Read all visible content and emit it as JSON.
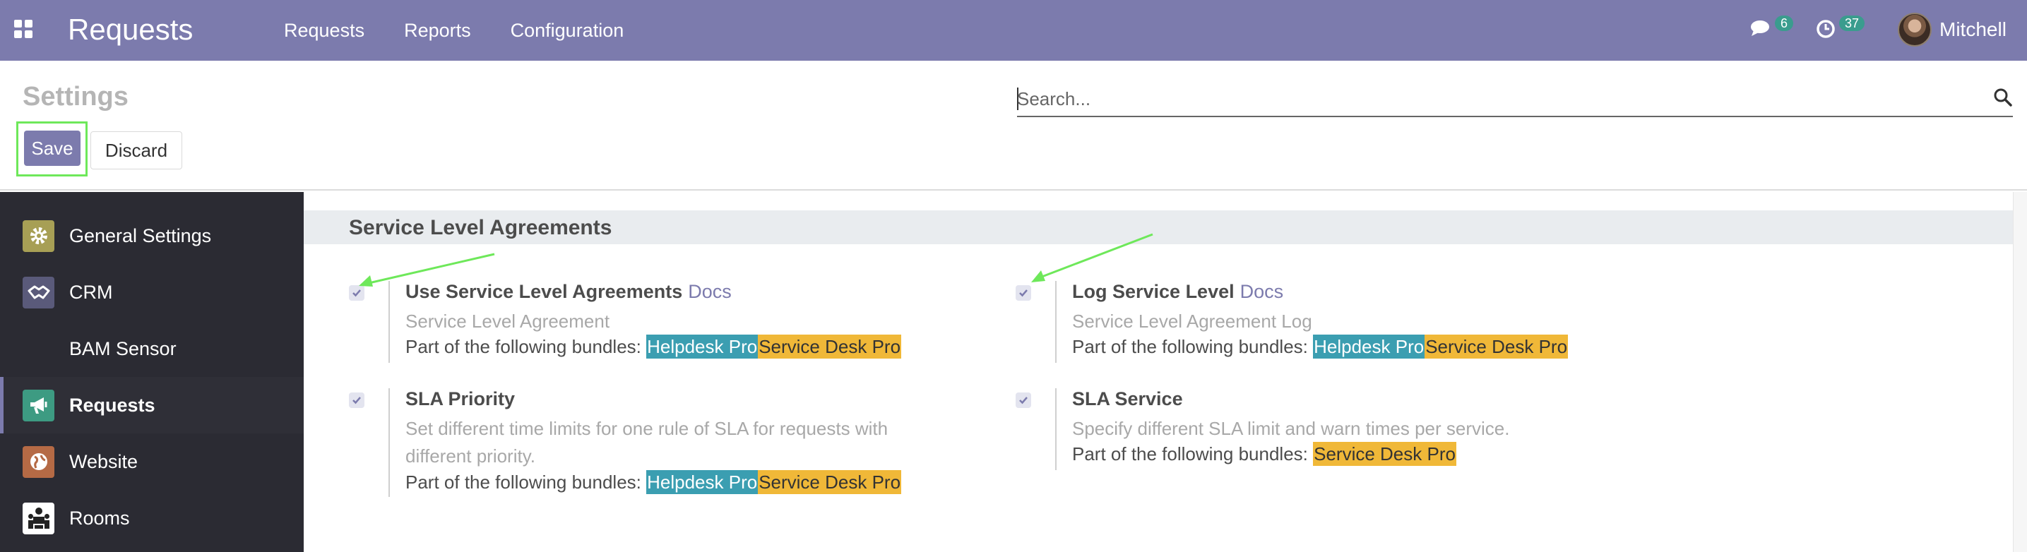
{
  "navbar": {
    "app_title": "Requests",
    "menu": [
      "Requests",
      "Reports",
      "Configuration"
    ],
    "chat_count": "6",
    "activity_count": "37",
    "user_name": "Mitchell"
  },
  "control_panel": {
    "title": "Settings",
    "save_label": "Save",
    "discard_label": "Discard",
    "search_placeholder": "Search..."
  },
  "sidebar": {
    "items": [
      {
        "label": "General Settings",
        "icon": "gear-icon"
      },
      {
        "label": "CRM",
        "icon": "handshake-icon"
      },
      {
        "label": "BAM Sensor",
        "icon": ""
      },
      {
        "label": "Requests",
        "icon": "megaphone-icon"
      },
      {
        "label": "Website",
        "icon": "globe-icon"
      },
      {
        "label": "Rooms",
        "icon": "rooms-icon"
      }
    ]
  },
  "section": {
    "title": "Service Level Agreements",
    "bundles_prefix": "Part of the following bundles:",
    "settings": [
      {
        "title": "Use Service Level Agreements",
        "docs": "Docs",
        "description": "Service Level Agreement",
        "bundles": [
          "Helpdesk Pro",
          "Service Desk Pro"
        ],
        "checked": true
      },
      {
        "title": "Log Service Level",
        "docs": "Docs",
        "description": "Service Level Agreement Log",
        "bundles": [
          "Helpdesk Pro",
          "Service Desk Pro"
        ],
        "checked": true
      },
      {
        "title": "SLA Priority",
        "docs": "",
        "description_lines": [
          "Set different time limits for one rule of SLA for requests with",
          "different priority."
        ],
        "bundles": [
          "Helpdesk Pro",
          "Service Desk Pro"
        ],
        "checked": true
      },
      {
        "title": "SLA Service",
        "docs": "",
        "description": "Specify different SLA limit and warn times per service.",
        "bundles": [
          "Service Desk Pro"
        ],
        "checked": true
      }
    ]
  },
  "colors": {
    "navbar": "#7c7bad",
    "sidebar": "#2b2b33",
    "tag_helpdesk": "#3b9eb1",
    "tag_service_desk": "#f0b838",
    "highlight_green": "#6ee85a"
  }
}
